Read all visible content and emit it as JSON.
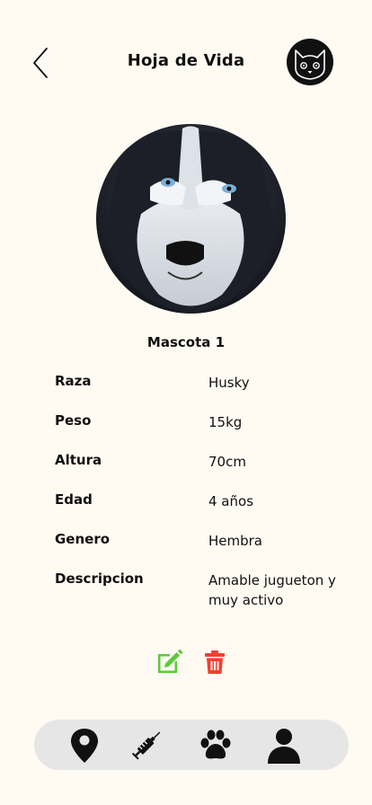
{
  "header": {
    "title": "Hoja de Vida",
    "back_icon": "chevron-left-icon",
    "logo_icon": "cat-face-logo"
  },
  "pet": {
    "name": "Mascota 1",
    "photo": "husky-photo",
    "fields": [
      {
        "label": "Raza",
        "value": "Husky"
      },
      {
        "label": "Peso",
        "value": "15kg"
      },
      {
        "label": "Altura",
        "value": "70cm"
      },
      {
        "label": "Edad",
        "value": "4 años"
      },
      {
        "label": "Genero",
        "value": "Hembra"
      },
      {
        "label": "Descripcion",
        "value": "Amable jugueton y muy activo"
      }
    ]
  },
  "actions": {
    "edit_icon": "edit-icon",
    "delete_icon": "trash-icon",
    "edit_color": "#5BCB3A",
    "delete_color": "#F0402E"
  },
  "bottom_nav": {
    "items": [
      "location-pin-icon",
      "syringe-icon",
      "paw-icon",
      "user-icon"
    ],
    "background": "#E6E6E6"
  },
  "colors": {
    "background": "#FFFAF2",
    "text": "#111111"
  }
}
